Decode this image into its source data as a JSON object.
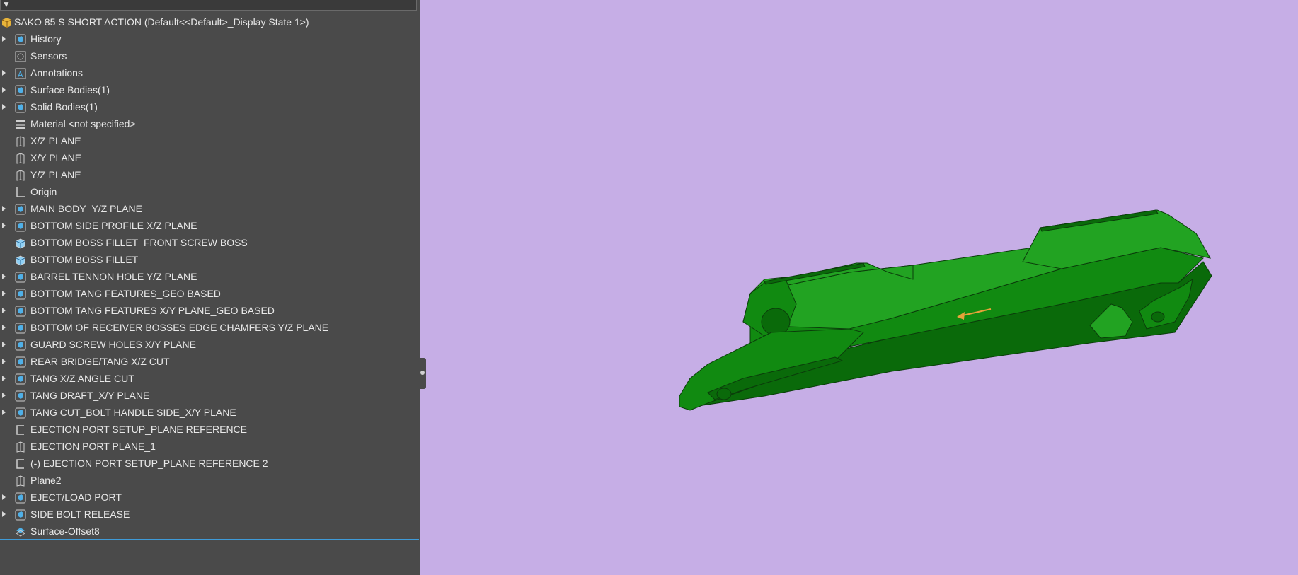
{
  "window": {
    "filter_icon": "filter-icon"
  },
  "tree": {
    "root_label": "SAKO 85 S SHORT ACTION  (Default<<Default>_Display State 1>)",
    "items": [
      {
        "label": "History",
        "icon": "history-icon",
        "expandable": true
      },
      {
        "label": "Sensors",
        "icon": "sensors-icon",
        "expandable": false
      },
      {
        "label": "Annotations",
        "icon": "annotations-icon",
        "expandable": true
      },
      {
        "label": "Surface Bodies(1)",
        "icon": "surface-bodies-icon",
        "expandable": true
      },
      {
        "label": "Solid Bodies(1)",
        "icon": "solid-bodies-icon",
        "expandable": true
      },
      {
        "label": "Material <not specified>",
        "icon": "material-icon",
        "expandable": false
      },
      {
        "label": "X/Z PLANE",
        "icon": "plane-icon",
        "expandable": false
      },
      {
        "label": "X/Y PLANE",
        "icon": "plane-icon",
        "expandable": false
      },
      {
        "label": "Y/Z PLANE",
        "icon": "plane-icon",
        "expandable": false
      },
      {
        "label": "Origin",
        "icon": "origin-icon",
        "expandable": false
      },
      {
        "label": "MAIN BODY_Y/Z PLANE",
        "icon": "feature-icon",
        "expandable": true
      },
      {
        "label": "BOTTOM SIDE PROFILE X/Z PLANE",
        "icon": "feature-icon",
        "expandable": true
      },
      {
        "label": "BOTTOM BOSS FILLET_FRONT SCREW BOSS",
        "icon": "fillet-icon",
        "expandable": false
      },
      {
        "label": "BOTTOM BOSS FILLET",
        "icon": "fillet-icon",
        "expandable": false
      },
      {
        "label": "BARREL TENNON HOLE Y/Z PLANE",
        "icon": "feature-icon",
        "expandable": true
      },
      {
        "label": "BOTTOM TANG FEATURES_GEO BASED",
        "icon": "feature-icon",
        "expandable": true
      },
      {
        "label": "BOTTOM TANG FEATURES X/Y PLANE_GEO BASED",
        "icon": "feature-icon",
        "expandable": true
      },
      {
        "label": "BOTTOM OF RECEIVER BOSSES EDGE CHAMFERS  Y/Z PLANE",
        "icon": "feature-icon",
        "expandable": true
      },
      {
        "label": "GUARD SCREW HOLES X/Y PLANE",
        "icon": "feature-icon",
        "expandable": true
      },
      {
        "label": "REAR BRIDGE/TANG X/Z CUT",
        "icon": "feature-icon",
        "expandable": true
      },
      {
        "label": "TANG X/Z ANGLE CUT",
        "icon": "feature-icon",
        "expandable": true
      },
      {
        "label": "TANG DRAFT_X/Y PLANE",
        "icon": "feature-icon",
        "expandable": true
      },
      {
        "label": "TANG CUT_BOLT HANDLE SIDE_X/Y PLANE",
        "icon": "feature-icon",
        "expandable": true
      },
      {
        "label": "EJECTION PORT SETUP_PLANE REFERENCE",
        "icon": "sketch-icon",
        "expandable": false
      },
      {
        "label": "EJECTION PORT PLANE_1",
        "icon": "plane-icon",
        "expandable": false
      },
      {
        "label": "(-) EJECTION PORT SETUP_PLANE REFERENCE 2",
        "icon": "sketch-icon",
        "expandable": false
      },
      {
        "label": "Plane2",
        "icon": "plane-icon",
        "expandable": false
      },
      {
        "label": "EJECT/LOAD PORT",
        "icon": "feature-icon",
        "expandable": true
      },
      {
        "label": "SIDE BOLT RELEASE",
        "icon": "feature-icon",
        "expandable": true
      },
      {
        "label": "Surface-Offset8",
        "icon": "surface-offset-icon",
        "expandable": false
      }
    ]
  },
  "viewport": {
    "background": "#c6aee6",
    "model_color": "#118a11",
    "model_dark": "#0a6a0a",
    "model_light": "#22a322",
    "edge_color": "#0b3d0b",
    "arrow_color": "#e8a23a",
    "model_icon": "receiver-part-model"
  }
}
